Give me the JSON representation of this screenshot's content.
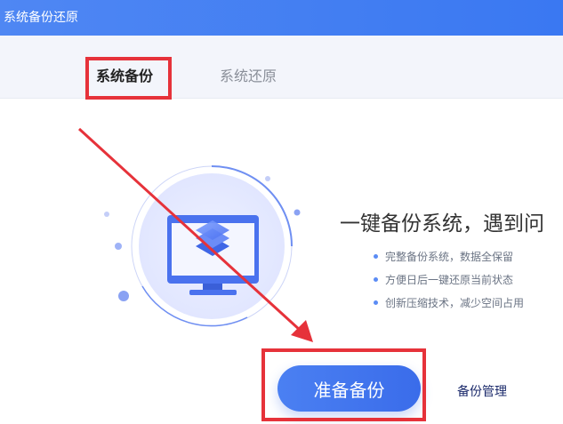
{
  "window": {
    "title": "系统备份还原"
  },
  "tabs": [
    {
      "label": "系统备份",
      "active": true
    },
    {
      "label": "系统还原",
      "active": false
    }
  ],
  "main": {
    "headline": "一键备份系统，遇到问",
    "features": [
      "完整备份系统，数据全保留",
      "方便日后一键还原当前状态",
      "创新压缩技术，减少空间占用"
    ],
    "primary_button_label": "准备备份",
    "manage_link_label": "备份管理"
  },
  "colors": {
    "accent": "#3a78f2",
    "highlight": "#e6323a",
    "tab_bar": "#f3f5fb"
  }
}
